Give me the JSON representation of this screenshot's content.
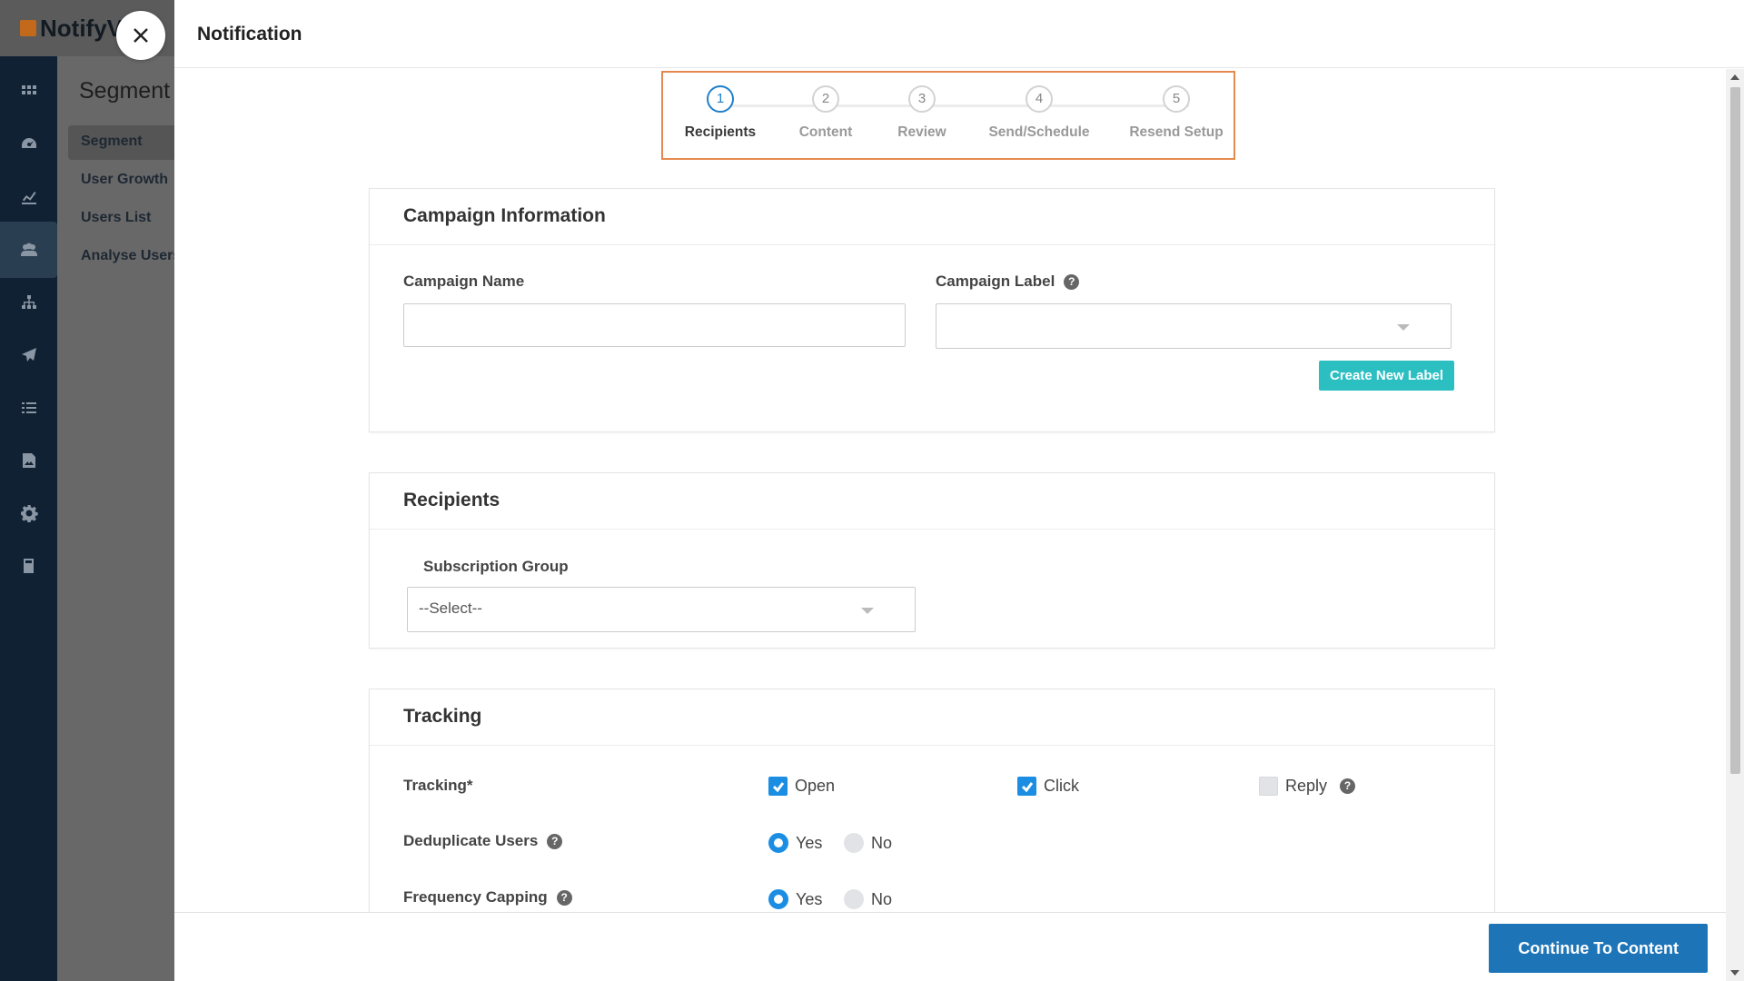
{
  "app": {
    "logo_text": "NotifyV",
    "sidebar_title": "Segment",
    "sidebar_items": [
      {
        "label": "Segment"
      },
      {
        "label": "User Growth"
      },
      {
        "label": "Users List"
      },
      {
        "label": "Analyse Users"
      }
    ],
    "rail_icons": [
      "grid-icon",
      "dashboard-icon",
      "chart-icon",
      "users-icon",
      "sitemap-icon",
      "send-icon",
      "list-icon",
      "image-icon",
      "settings-icon",
      "book-icon"
    ],
    "active_rail_icon": "users-icon"
  },
  "drawer": {
    "title": "Notification",
    "stepper": {
      "active_step": 1,
      "steps": [
        {
          "number": "1",
          "label": "Recipients"
        },
        {
          "number": "2",
          "label": "Content"
        },
        {
          "number": "3",
          "label": "Review"
        },
        {
          "number": "4",
          "label": "Send/Schedule"
        },
        {
          "number": "5",
          "label": "Resend Setup"
        }
      ]
    },
    "campaign_info": {
      "heading": "Campaign Information",
      "name_label": "Campaign Name",
      "name_value": "",
      "label_label": "Campaign Label",
      "label_value": "",
      "create_label_button": "Create New Label"
    },
    "recipients": {
      "heading": "Recipients",
      "subscription_label": "Subscription Group",
      "subscription_value": "--Select--"
    },
    "tracking": {
      "heading": "Tracking",
      "tracking_label": "Tracking*",
      "open_label": "Open",
      "open_checked": true,
      "click_label": "Click",
      "click_checked": true,
      "reply_label": "Reply",
      "reply_checked": false,
      "dedupe_label": "Deduplicate Users",
      "frequency_label": "Frequency Capping",
      "yes_label": "Yes",
      "no_label": "No",
      "dedupe_selected": "Yes",
      "frequency_selected": "Yes"
    },
    "footer": {
      "continue_button": "Continue To Content"
    }
  },
  "colors": {
    "accent_blue": "#1d75b8",
    "checkbox_blue": "#1b8ee4",
    "teal": "#2cbfc2",
    "stepper_highlight": "#e58a4e",
    "rail_bg": "#0f2133"
  }
}
